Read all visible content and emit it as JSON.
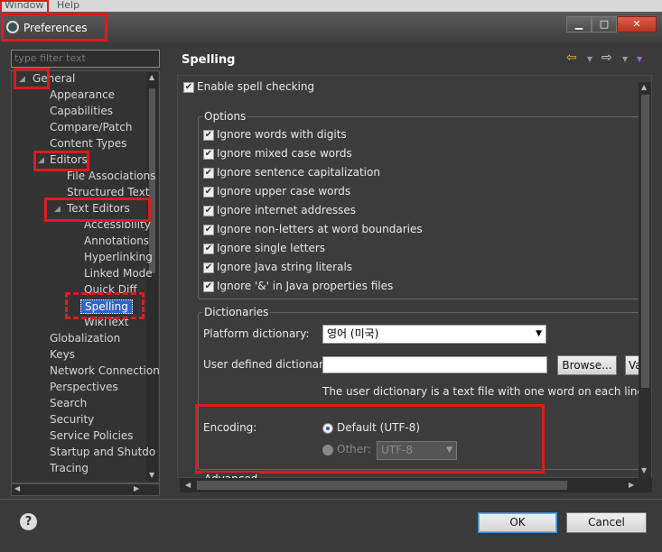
{
  "menubar": {
    "items": [
      "Window",
      "Help"
    ]
  },
  "window": {
    "title": "Preferences",
    "controls": [
      "minimize-icon",
      "maximize-icon",
      "close-icon"
    ]
  },
  "filter": {
    "placeholder": "type filter text"
  },
  "tree": {
    "nodes": [
      {
        "label": "General",
        "expanded": true
      },
      {
        "label": "Appearance"
      },
      {
        "label": "Capabilities"
      },
      {
        "label": "Compare/Patch"
      },
      {
        "label": "Content Types"
      },
      {
        "label": "Editors",
        "expanded": true
      },
      {
        "label": "File Associations"
      },
      {
        "label": "Structured Text"
      },
      {
        "label": "Text Editors",
        "expanded": true
      },
      {
        "label": "Accessibility"
      },
      {
        "label": "Annotations"
      },
      {
        "label": "Hyperlinking"
      },
      {
        "label": "Linked Mode"
      },
      {
        "label": "Quick Diff"
      },
      {
        "label": "Spelling",
        "selected": true
      },
      {
        "label": "WikiText"
      },
      {
        "label": "Globalization"
      },
      {
        "label": "Keys"
      },
      {
        "label": "Network Connection"
      },
      {
        "label": "Perspectives"
      },
      {
        "label": "Search"
      },
      {
        "label": "Security"
      },
      {
        "label": "Service Policies"
      },
      {
        "label": "Startup and Shutdo"
      },
      {
        "label": "Tracing"
      }
    ]
  },
  "page": {
    "title": "Spelling",
    "enable_spell": "Enable spell checking",
    "options_group": "Options",
    "options": [
      "Ignore words with digits",
      "Ignore mixed case words",
      "Ignore sentence capitalization",
      "Ignore upper case words",
      "Ignore internet addresses",
      "Ignore non-letters at word boundaries",
      "Ignore single letters",
      "Ignore Java string literals",
      "Ignore '&' in Java properties files"
    ],
    "dictionaries_group": "Dictionaries",
    "platform_dict_label": "Platform dictionary:",
    "platform_dict_value": "영어 (미국)",
    "user_dict_label": "User defined dictionary:",
    "user_dict_value": "",
    "browse_button": "Browse...",
    "variables_button": "Va",
    "user_dict_hint": "The user dictionary is a text file with one word on each line",
    "encoding_label": "Encoding:",
    "encoding_default": "Default (UTF-8)",
    "encoding_other": "Other:",
    "encoding_other_value": "UTF-8",
    "advanced_group": "Advanced"
  },
  "footer": {
    "ok": "OK",
    "cancel": "Cancel"
  },
  "colors": {
    "highlight": "#e01a1a",
    "selection": "#2f65ca"
  }
}
